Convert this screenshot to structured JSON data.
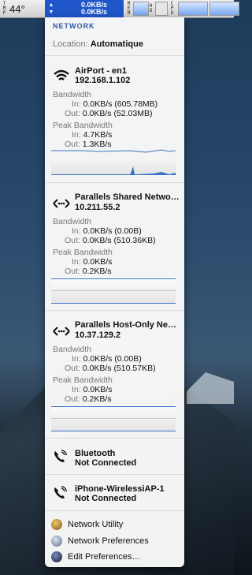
{
  "menubar": {
    "tmp_label": "TMP",
    "temperature": "44°",
    "net_up": "0.0KB/s",
    "net_down": "0.0KB/s",
    "mem_label": "MEM",
    "hd_label": "HD",
    "cpu_label": "CPU"
  },
  "menu": {
    "header": "NETWORK",
    "location_label": "Location:",
    "location_value": "Automatique",
    "interfaces": [
      {
        "name": "AirPort - en1",
        "ip": "192.168.1.102",
        "icon": "wifi-icon",
        "bandwidth_label": "Bandwidth",
        "in_label": "In:",
        "in_value": "0.0KB/s (605.78MB)",
        "out_label": "Out:",
        "out_value": "0.0KB/s (52.03MB)",
        "peak_label": "Peak Bandwidth",
        "peak_in": "4.7KB/s",
        "peak_out": "1.3KB/s"
      },
      {
        "name": "Parallels Shared Netwo…",
        "ip": "10.211.55.2",
        "icon": "ethernet-icon",
        "bandwidth_label": "Bandwidth",
        "in_label": "In:",
        "in_value": "0.0KB/s (0.00B)",
        "out_label": "Out:",
        "out_value": "0.0KB/s (510.36KB)",
        "peak_label": "Peak Bandwidth",
        "peak_in": "0.0KB/s",
        "peak_out": "0.2KB/s"
      },
      {
        "name": "Parallels Host-Only Ne…",
        "ip": "10.37.129.2",
        "icon": "ethernet-icon",
        "bandwidth_label": "Bandwidth",
        "in_label": "In:",
        "in_value": "0.0KB/s (0.00B)",
        "out_label": "Out:",
        "out_value": "0.0KB/s (510.57KB)",
        "peak_label": "Peak Bandwidth",
        "peak_in": "0.0KB/s",
        "peak_out": "0.2KB/s"
      }
    ],
    "modems": [
      {
        "name": "Bluetooth",
        "status": "Not Connected"
      },
      {
        "name": "iPhone-WirelessiAP-1",
        "status": "Not Connected"
      }
    ],
    "footer": {
      "network_utility": "Network Utility",
      "network_preferences": "Network Preferences",
      "edit_preferences": "Edit Preferences…"
    }
  },
  "colors": {
    "accent": "#1f56c9",
    "header_text": "#2a5aa8",
    "graph_line": "#3a72c8"
  }
}
